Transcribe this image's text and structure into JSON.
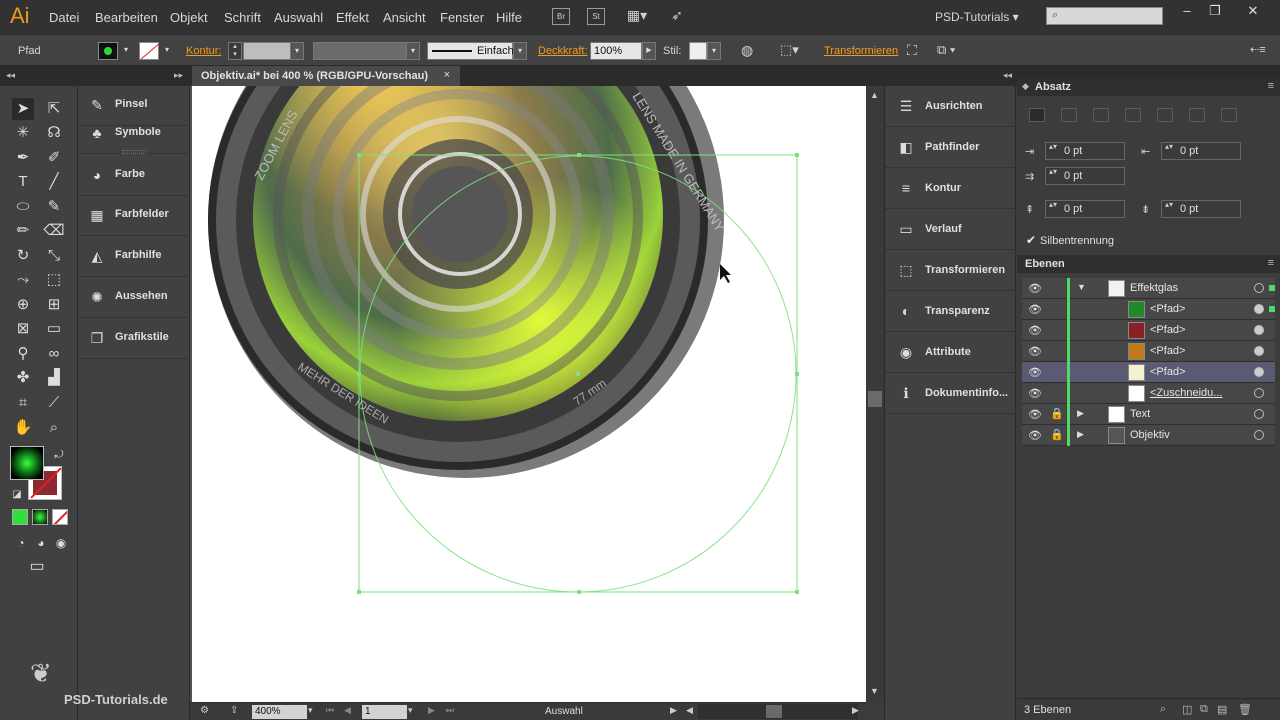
{
  "app": {
    "logo": "Ai",
    "menu": [
      "Datei",
      "Bearbeiten",
      "Objekt",
      "Schrift",
      "Auswahl",
      "Effekt",
      "Ansicht",
      "Fenster",
      "Hilfe"
    ],
    "bridge_btn": "Br",
    "stock_btn": "St",
    "workspace": "PSD-Tutorials",
    "window_controls": [
      "–",
      "❐",
      "✕"
    ]
  },
  "control_bar": {
    "selection_type": "Pfad",
    "kontur_label": "Kontur:",
    "stroke_style": "Einfach",
    "deckkraft_label": "Deckkraft:",
    "deckkraft_value": "100%",
    "stil_label": "Stil:",
    "transformieren_label": "Transformieren"
  },
  "document": {
    "tab_title": "Objektiv.ai* bei 400 % (RGB/GPU-Vorschau)",
    "close": "×",
    "lens_text_top_left": "ZOOM LENS",
    "lens_text_top_right": "LENS MADE IN GERMANY",
    "lens_text_bottom_left": "MEHR DER IDEEN",
    "lens_text_bottom_right": "77 mm"
  },
  "status_bar": {
    "zoom": "400%",
    "artboard": "1",
    "tool": "Auswahl"
  },
  "icon_panel_1": [
    {
      "label": "Pinsel",
      "icon": "brush-icon",
      "glyph": "✎"
    },
    {
      "label": "Symbole",
      "icon": "symbols-icon",
      "glyph": "♣"
    },
    {
      "label": "Farbe",
      "icon": "color-icon",
      "glyph": "◕"
    },
    {
      "label": "Farbfelder",
      "icon": "swatches-icon",
      "glyph": "▦"
    },
    {
      "label": "Farbhilfe",
      "icon": "color-guide-icon",
      "glyph": "◭"
    },
    {
      "label": "Aussehen",
      "icon": "appearance-icon",
      "glyph": "✺"
    },
    {
      "label": "Grafikstile",
      "icon": "graphic-styles-icon",
      "glyph": "❐"
    }
  ],
  "icon_panel_2": [
    {
      "label": "Ausrichten",
      "icon": "align-icon",
      "glyph": "☰"
    },
    {
      "label": "Pathfinder",
      "icon": "pathfinder-icon",
      "glyph": "◧"
    },
    {
      "label": "Kontur",
      "icon": "stroke-icon",
      "glyph": "≡"
    },
    {
      "label": "Verlauf",
      "icon": "gradient-icon",
      "glyph": "▭"
    },
    {
      "label": "Transformieren",
      "icon": "transform-icon",
      "glyph": "⬚"
    },
    {
      "label": "Transparenz",
      "icon": "transparency-icon",
      "glyph": "◐"
    },
    {
      "label": "Attribute",
      "icon": "attributes-icon",
      "glyph": "◉"
    },
    {
      "label": "Dokumentinfo...",
      "icon": "document-info-icon",
      "glyph": "ℹ"
    }
  ],
  "absatz_panel": {
    "title": "Absatz",
    "left_indent": "0 pt",
    "right_indent": "0 pt",
    "first_line_indent": "0 pt",
    "space_before": "0 pt",
    "space_after": "0 pt",
    "hyphenation_label": "Silbentrennung",
    "hyphenation_checked": true
  },
  "layers_panel": {
    "title": "Ebenen",
    "rows": [
      {
        "name": "Effektglas",
        "indent": 0,
        "expanded": true,
        "locked": false,
        "thumb_color": "#f2f2f2",
        "target_filled": false,
        "selected": false,
        "sel_marker": true
      },
      {
        "name": "<Pfad>",
        "indent": 1,
        "expanded": null,
        "locked": false,
        "thumb_color": "#1f8a2a",
        "target_filled": true,
        "selected": false,
        "sel_marker": true
      },
      {
        "name": "<Pfad>",
        "indent": 1,
        "expanded": null,
        "locked": false,
        "thumb_color": "#8a1f24",
        "target_filled": true,
        "selected": false,
        "sel_marker": false
      },
      {
        "name": "<Pfad>",
        "indent": 1,
        "expanded": null,
        "locked": false,
        "thumb_color": "#c07a1a",
        "target_filled": true,
        "selected": false,
        "sel_marker": false
      },
      {
        "name": "<Pfad>",
        "indent": 1,
        "expanded": null,
        "locked": false,
        "thumb_color": "#f5f0d0",
        "target_filled": true,
        "selected": true,
        "sel_marker": false
      },
      {
        "name": "<Zuschneidu...",
        "indent": 1,
        "expanded": null,
        "locked": false,
        "thumb_color": "#ffffff",
        "target_filled": false,
        "selected": false,
        "sel_marker": false
      },
      {
        "name": "Text",
        "indent": 0,
        "expanded": false,
        "locked": true,
        "thumb_color": "#ffffff",
        "target_filled": false,
        "selected": false,
        "sel_marker": false
      },
      {
        "name": "Objektiv",
        "indent": 0,
        "expanded": false,
        "locked": true,
        "thumb_color": "#555555",
        "target_filled": false,
        "selected": false,
        "sel_marker": false
      }
    ],
    "count_label": "3 Ebenen"
  },
  "watermark": "PSD-Tutorials.de",
  "colors": {
    "accent_orange": "#f09a1e",
    "layer_green": "#52d86a",
    "selection_green": "#7ee07f"
  }
}
